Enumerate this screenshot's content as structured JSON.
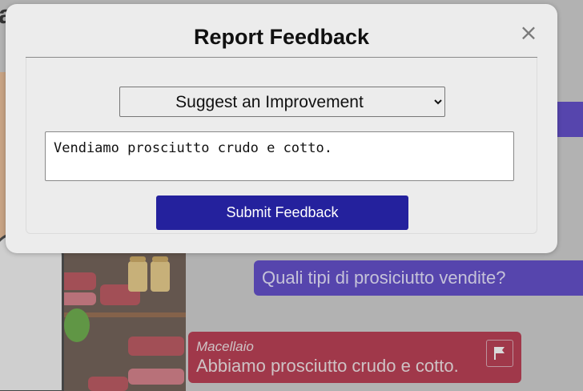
{
  "background": {
    "header_fragment": "a",
    "chat": {
      "user_message": "Quali tipi di prosiciutto vendite?",
      "bot_name": "Macellaio",
      "bot_message": "Abbiamo prosciutto crudo e cotto."
    }
  },
  "modal": {
    "title": "Report Feedback",
    "close_glyph": "×",
    "feedback_type": {
      "selected": "Suggest an Improvement",
      "options": [
        "Suggest an Improvement"
      ]
    },
    "feedback_text": "Vendiamo prosciutto crudo e cotto.",
    "submit_label": "Submit Feedback"
  },
  "icons": {
    "flag": "flag-icon",
    "close": "close-icon"
  },
  "colors": {
    "modal_bg": "#ececec",
    "submit_bg": "#24219d",
    "user_bubble": "#4a33c2",
    "bot_bubble": "#b0203a"
  }
}
